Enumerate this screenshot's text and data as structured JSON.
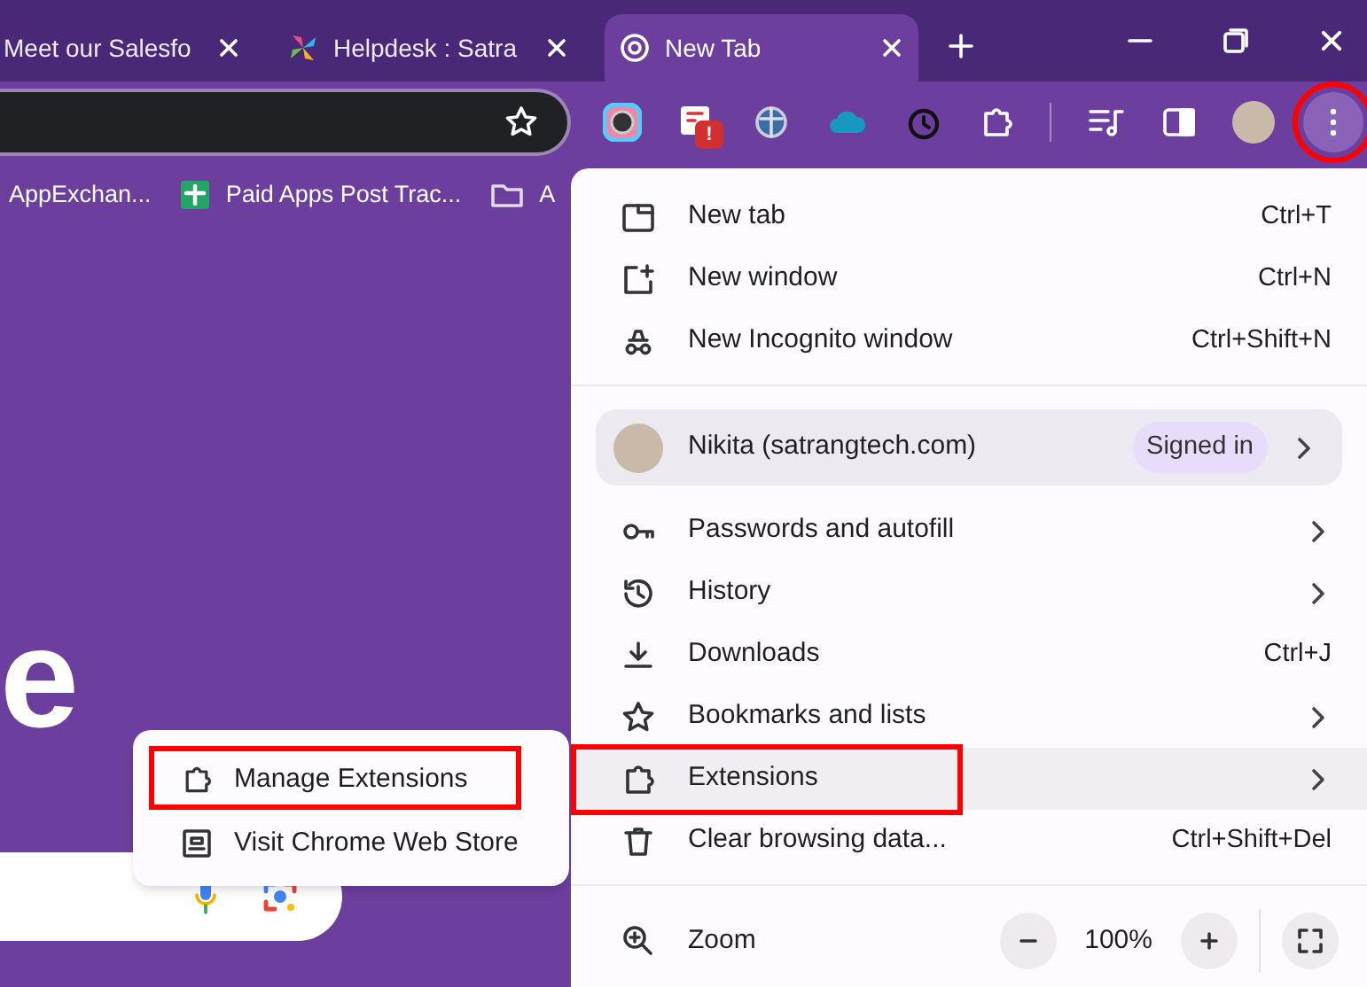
{
  "tabs": [
    {
      "title": "Meet our Salesfo",
      "selected": false
    },
    {
      "title": "Helpdesk : Satra",
      "selected": false
    },
    {
      "title": "New Tab",
      "selected": true
    }
  ],
  "toolbar": {
    "extension_badge": "!",
    "menu_button": {
      "highlighted": true
    }
  },
  "bookmarks": [
    {
      "kind": "plain",
      "label": "AppExchan..."
    },
    {
      "kind": "sheet",
      "label": "Paid Apps Post Trac..."
    },
    {
      "kind": "folder",
      "label": "A"
    }
  ],
  "page": {
    "logo_fragment": "e"
  },
  "menu": {
    "items": [
      {
        "kind": "item",
        "label": "New tab",
        "shortcut": "Ctrl+T",
        "submenu": false,
        "hovered": false,
        "highlighted": false
      },
      {
        "kind": "item",
        "label": "New window",
        "shortcut": "Ctrl+N",
        "submenu": false,
        "hovered": false,
        "highlighted": false
      },
      {
        "kind": "item",
        "label": "New Incognito window",
        "shortcut": "Ctrl+Shift+N",
        "submenu": false,
        "hovered": false,
        "highlighted": false
      },
      {
        "kind": "divider"
      },
      {
        "kind": "profile",
        "label": "Nikita (satrangtech.com)",
        "badge": "Signed in",
        "submenu": true
      },
      {
        "kind": "item",
        "label": "Passwords and autofill",
        "submenu": true,
        "hovered": false,
        "highlighted": false
      },
      {
        "kind": "item",
        "label": "History",
        "submenu": true,
        "hovered": false,
        "highlighted": false
      },
      {
        "kind": "item",
        "label": "Downloads",
        "shortcut": "Ctrl+J",
        "submenu": false,
        "hovered": false,
        "highlighted": false
      },
      {
        "kind": "item",
        "label": "Bookmarks and lists",
        "submenu": true,
        "hovered": false,
        "highlighted": false
      },
      {
        "kind": "item",
        "label": "Extensions",
        "submenu": true,
        "hovered": true,
        "highlighted": true
      },
      {
        "kind": "item",
        "label": "Clear browsing data...",
        "shortcut": "Ctrl+Shift+Del",
        "submenu": false,
        "hovered": false,
        "highlighted": false
      },
      {
        "kind": "divider"
      },
      {
        "kind": "zoom",
        "label": "Zoom",
        "value": "100%"
      }
    ]
  },
  "submenu": {
    "items": [
      {
        "label": "Manage Extensions",
        "highlighted": true
      },
      {
        "label": "Visit Chrome Web Store",
        "highlighted": false
      }
    ]
  }
}
